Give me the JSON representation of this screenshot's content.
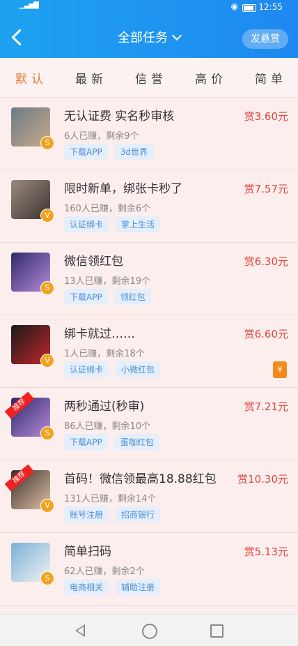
{
  "status": {
    "time": "12:55"
  },
  "header": {
    "title": "全部任务",
    "post_label": "发悬赏"
  },
  "tabs": [
    {
      "label": "默认",
      "active": true
    },
    {
      "label": "最新",
      "active": false
    },
    {
      "label": "信誉",
      "active": false
    },
    {
      "label": "高价",
      "active": false
    },
    {
      "label": "简单",
      "active": false
    }
  ],
  "tasks": [
    {
      "title": "无认证费 实名秒审核",
      "meta": "6人已赚，剩余9个",
      "tags": [
        "下载APP",
        "3d世界"
      ],
      "price": "赏3.60元",
      "badge": "S",
      "ribbon": "",
      "colors": [
        "#6b7b86",
        "#c9a98a"
      ]
    },
    {
      "title": "限时新单，绑张卡秒了",
      "meta": "160人已赚，剩余6个",
      "tags": [
        "认证绑卡",
        "掌上生活"
      ],
      "price": "赏7.57元",
      "badge": "V",
      "ribbon": "",
      "colors": [
        "#9a8a7d",
        "#3c3431"
      ]
    },
    {
      "title": "微信领红包",
      "meta": "13人已赚，剩余19个",
      "tags": [
        "下载APP",
        "领红包"
      ],
      "price": "赏6.30元",
      "badge": "S",
      "ribbon": "",
      "colors": [
        "#2e2a6e",
        "#b68ad6"
      ]
    },
    {
      "title": "绑卡就过……",
      "meta": "1人已赚，剩余18个",
      "tags": [
        "认证绑卡",
        "小微红包"
      ],
      "price": "赏6.60元",
      "badge": "V",
      "ribbon": "",
      "redpack": "¥",
      "colors": [
        "#1a1a1a",
        "#c2262b"
      ]
    },
    {
      "title": "两秒通过(秒审)",
      "meta": "86人已赚，剩余10个",
      "tags": [
        "下载APP",
        "蛋咖红包"
      ],
      "price": "赏7.21元",
      "badge": "S",
      "ribbon": "推荐",
      "colors": [
        "#2e2a6e",
        "#b68ad6"
      ]
    },
    {
      "title": "首码！微信领最高18.88红包",
      "meta": "131人已赚，剩余14个",
      "tags": [
        "账号注册",
        "招商银行"
      ],
      "price": "赏10.30元",
      "badge": "V",
      "ribbon": "推荐",
      "colors": [
        "#3b2e2a",
        "#e0c1a6"
      ]
    },
    {
      "title": "简单扫码",
      "meta": "62人已赚，剩余2个",
      "tags": [
        "电商相关",
        "辅助注册"
      ],
      "price": "赏5.13元",
      "badge": "S",
      "ribbon": "",
      "colors": [
        "#7ab0d6",
        "#f2f2f2"
      ]
    }
  ]
}
